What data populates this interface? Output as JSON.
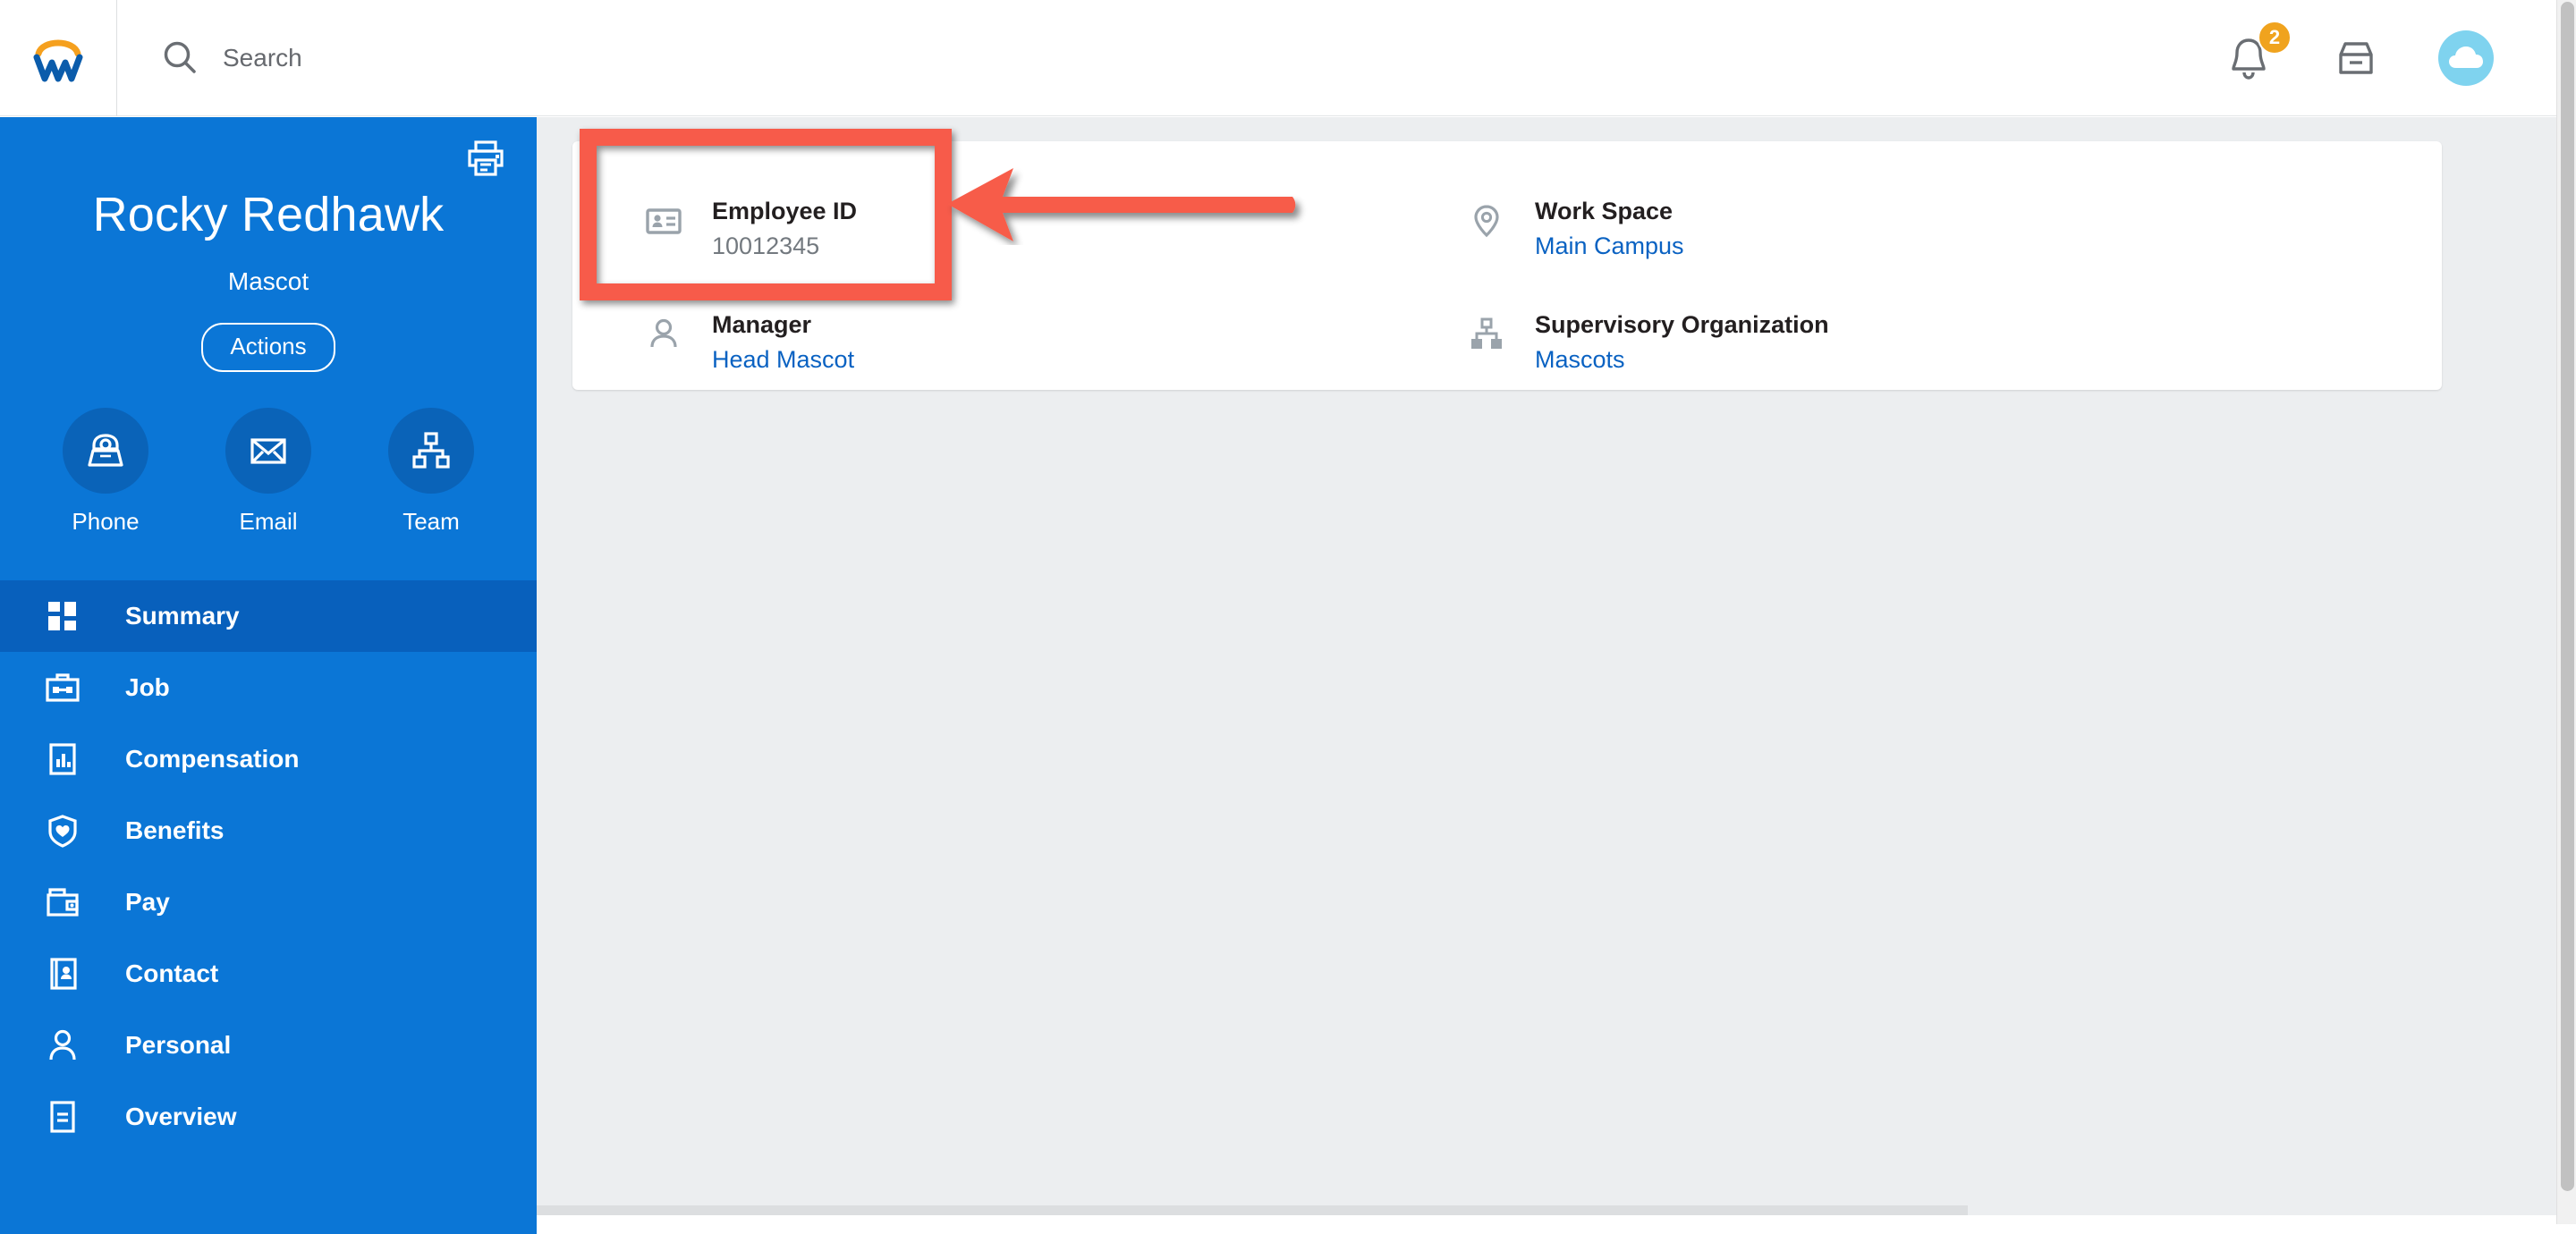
{
  "topbar": {
    "logo": "workday-w-logo",
    "search": {
      "placeholder": "Search",
      "value": ""
    },
    "notifications": {
      "icon": "bell-icon",
      "count": "2"
    },
    "inbox": {
      "icon": "inbox-icon"
    },
    "profile": {
      "icon": "cloud-avatar-icon"
    }
  },
  "sidebar": {
    "print_icon": "printer-icon",
    "profile": {
      "name": "Rocky Redhawk",
      "title": "Mascot",
      "actions_label": "Actions"
    },
    "quick_actions": [
      {
        "label": "Phone",
        "icon": "phone-icon"
      },
      {
        "label": "Email",
        "icon": "envelope-icon"
      },
      {
        "label": "Team",
        "icon": "org-chart-icon"
      }
    ],
    "nav": [
      {
        "label": "Summary",
        "icon": "grid-icon",
        "active": true
      },
      {
        "label": "Job",
        "icon": "briefcase-icon",
        "active": false
      },
      {
        "label": "Compensation",
        "icon": "bar-chart-doc-icon",
        "active": false
      },
      {
        "label": "Benefits",
        "icon": "shield-heart-icon",
        "active": false
      },
      {
        "label": "Pay",
        "icon": "wallet-icon",
        "active": false
      },
      {
        "label": "Contact",
        "icon": "address-book-icon",
        "active": false
      },
      {
        "label": "Personal",
        "icon": "person-icon",
        "active": false
      },
      {
        "label": "Overview",
        "icon": "document-lines-icon",
        "active": false
      }
    ]
  },
  "main": {
    "fields": {
      "employee_id": {
        "label": "Employee ID",
        "value": "10012345",
        "icon": "id-badge-icon",
        "is_link": false
      },
      "manager": {
        "label": "Manager",
        "value": "Head Mascot",
        "icon": "person-icon",
        "is_link": true
      },
      "work_space": {
        "label": "Work Space",
        "value": "Main Campus",
        "icon": "location-pin-icon",
        "is_link": true
      },
      "supervisory": {
        "label": "Supervisory Organization",
        "value": "Mascots",
        "icon": "org-chart-icon",
        "is_link": true
      }
    }
  },
  "annotations": {
    "highlight_box": {
      "target": "employee-id-field",
      "color": "#f75b4a"
    },
    "arrow": {
      "direction": "left",
      "points_to": "employee-id-field",
      "color": "#f75b4a"
    }
  },
  "colors": {
    "brand_blue": "#0b76d6",
    "brand_blue_dark": "#0860bc",
    "brand_orange": "#f5a01e",
    "link_blue": "#0a62c2",
    "annotation_red": "#f75b4a",
    "canvas_gray": "#eceef0"
  }
}
